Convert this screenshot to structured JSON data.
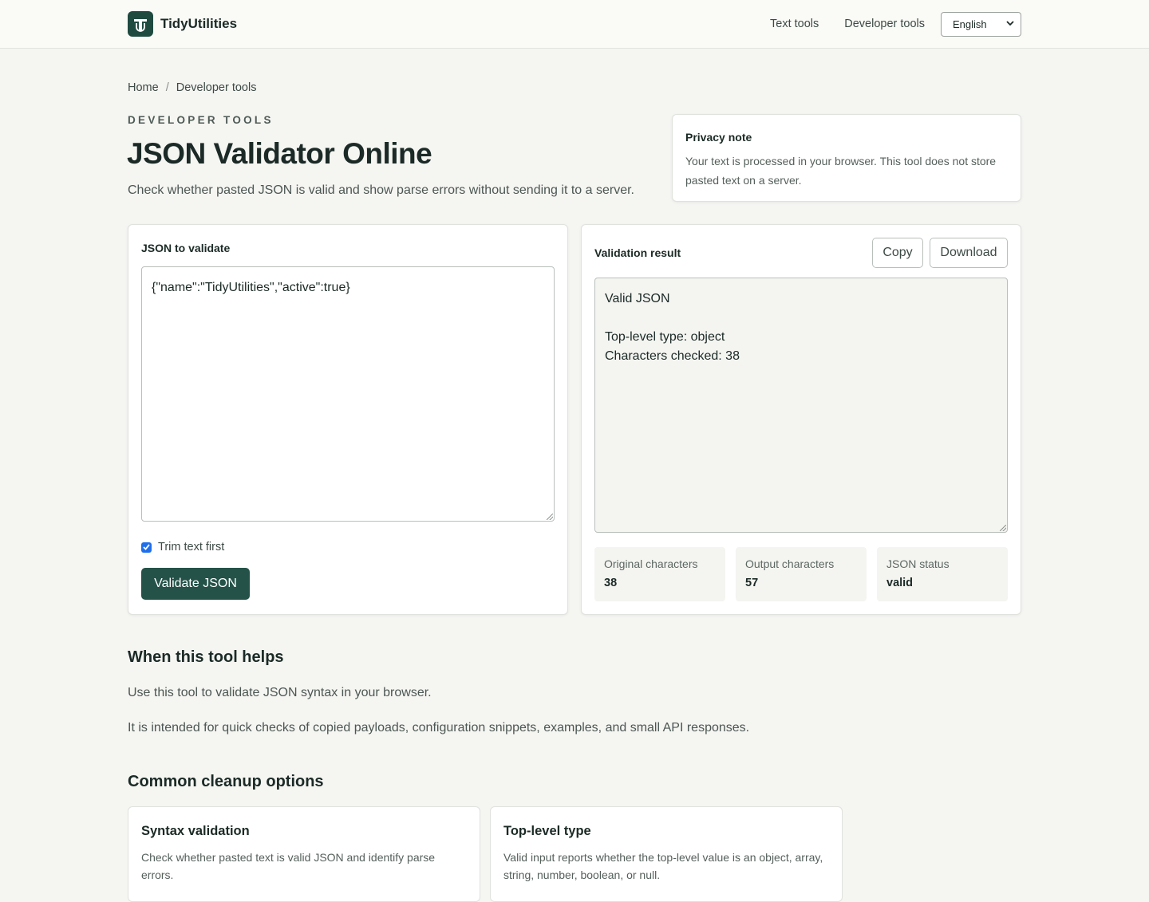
{
  "header": {
    "brand": "TidyUtilities",
    "nav": [
      "Text tools",
      "Developer tools"
    ],
    "language": "English"
  },
  "breadcrumb": [
    "Home",
    "Developer tools"
  ],
  "hero": {
    "eyebrow": "DEVELOPER TOOLS",
    "title": "JSON Validator Online",
    "description": "Check whether pasted JSON is valid and show parse errors without sending it to a server."
  },
  "privacy": {
    "title": "Privacy note",
    "text": "Your text is processed in your browser. This tool does not store pasted text on a server."
  },
  "input_panel": {
    "label": "JSON to validate",
    "value": "{\"name\":\"TidyUtilities\",\"active\":true}",
    "trim_label": "Trim text first",
    "trim_checked": true,
    "validate_label": "Validate JSON"
  },
  "result_panel": {
    "label": "Validation result",
    "copy_label": "Copy",
    "download_label": "Download",
    "output": "Valid JSON\n\nTop-level type: object\nCharacters checked: 38",
    "stats": [
      {
        "label": "Original characters",
        "value": "38"
      },
      {
        "label": "Output characters",
        "value": "57"
      },
      {
        "label": "JSON status",
        "value": "valid"
      }
    ]
  },
  "helps": {
    "title": "When this tool helps",
    "paragraphs": [
      "Use this tool to validate JSON syntax in your browser.",
      "It is intended for quick checks of copied payloads, configuration snippets, examples, and small API responses."
    ]
  },
  "options": {
    "title": "Common cleanup options",
    "cards": [
      {
        "title": "Syntax validation",
        "text": "Check whether pasted text is valid JSON and identify parse errors."
      },
      {
        "title": "Top-level type",
        "text": "Valid input reports whether the top-level value is an object, array, string, number, boolean, or null."
      }
    ]
  },
  "colors": {
    "primary": "#245248",
    "logo": "#1f4a40",
    "checkbox": "#1f6feb"
  }
}
